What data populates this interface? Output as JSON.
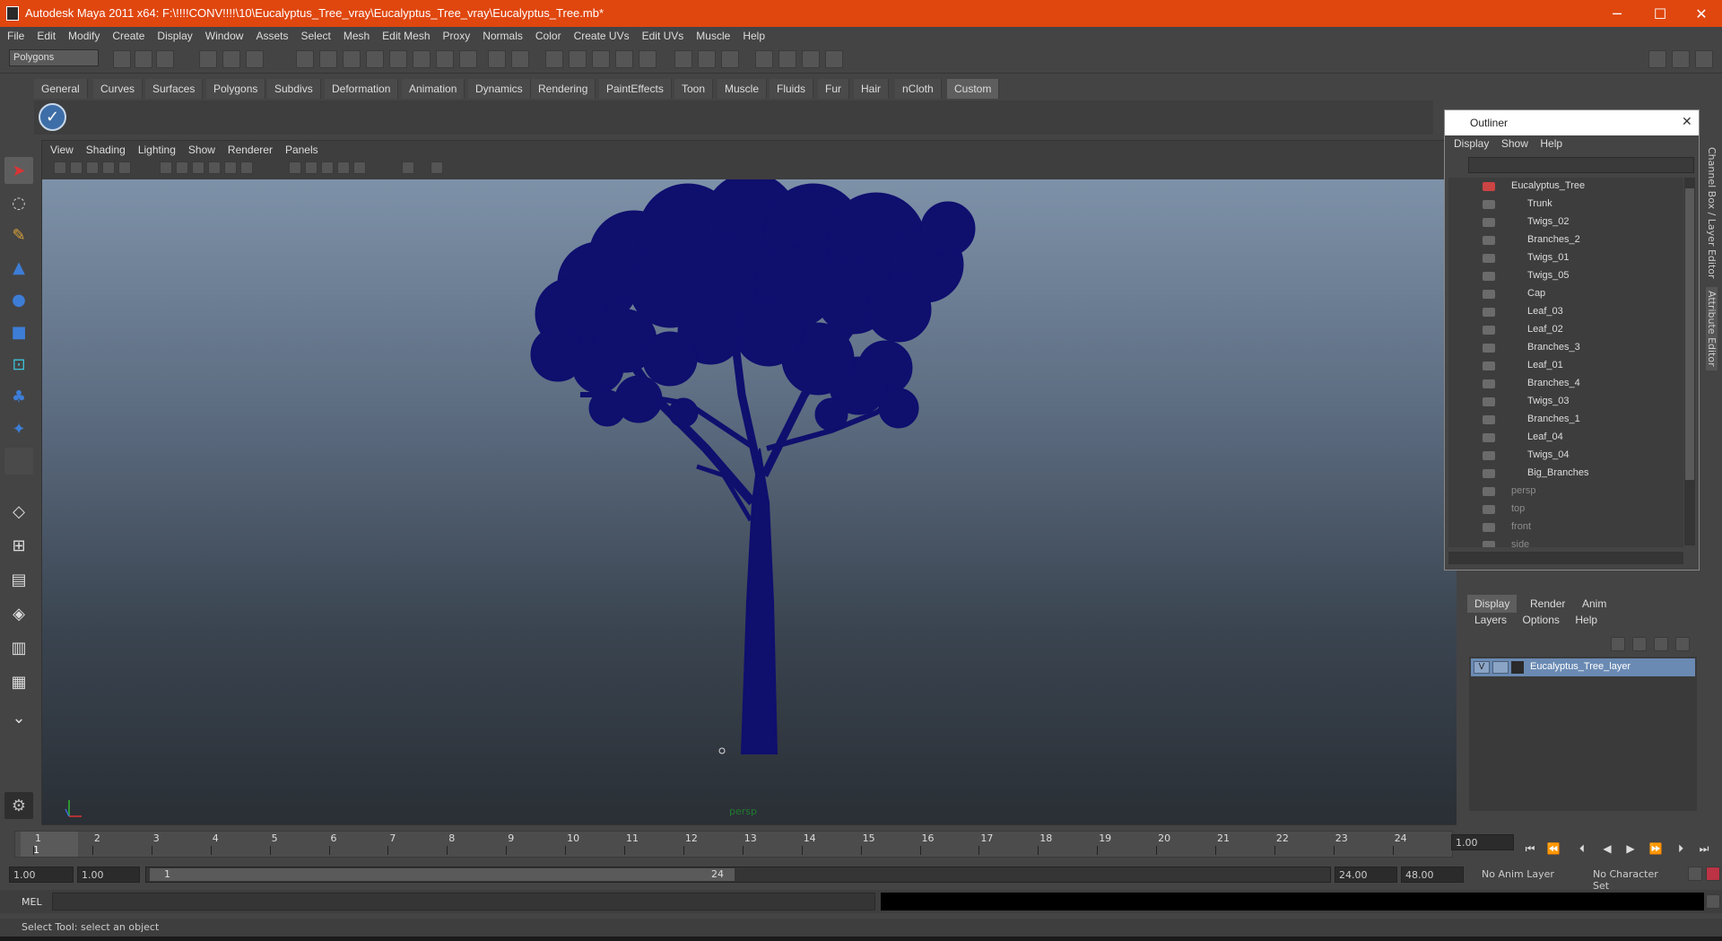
{
  "window": {
    "title": "Autodesk Maya 2011 x64: F:\\!!!!CONV!!!!\\10\\Eucalyptus_Tree_vray\\Eucalyptus_Tree_vray\\Eucalyptus_Tree.mb*",
    "minimize": "─",
    "maximize": "☐",
    "close": "✕"
  },
  "menubar": [
    "File",
    "Edit",
    "Modify",
    "Create",
    "Display",
    "Window",
    "Assets",
    "Select",
    "Mesh",
    "Edit Mesh",
    "Proxy",
    "Normals",
    "Color",
    "Create UVs",
    "Edit UVs",
    "Muscle",
    "Help"
  ],
  "statusline": {
    "mode": "Polygons"
  },
  "shelf_tabs": [
    "General",
    "Curves",
    "Surfaces",
    "Polygons",
    "Subdivs",
    "Deformation",
    "Animation",
    "Dynamics",
    "Rendering",
    "PaintEffects",
    "Toon",
    "Muscle",
    "Fluids",
    "Fur",
    "Hair",
    "nCloth",
    "Custom"
  ],
  "shelf_active": "Custom",
  "viewport": {
    "menu": [
      "View",
      "Shading",
      "Lighting",
      "Show",
      "Renderer",
      "Panels"
    ],
    "camera_label": "persp",
    "tree_color": "#0f0f6e"
  },
  "outliner": {
    "title": "Outliner",
    "menu": [
      "Display",
      "Show",
      "Help"
    ],
    "root": "Eucalyptus_Tree",
    "children": [
      "Trunk",
      "Twigs_02",
      "Branches_2",
      "Twigs_01",
      "Twigs_05",
      "Cap",
      "Leaf_03",
      "Leaf_02",
      "Branches_3",
      "Leaf_01",
      "Branches_4",
      "Twigs_03",
      "Branches_1",
      "Leaf_04",
      "Twigs_04",
      "Big_Branches"
    ],
    "cameras": [
      "persp",
      "top",
      "front",
      "side"
    ]
  },
  "dock_tabs": {
    "channel_box": "Channel Box / Layer Editor",
    "attribute_editor": "Attribute Editor"
  },
  "layer_editor": {
    "tabs": [
      "Display",
      "Render",
      "Anim"
    ],
    "menu": [
      "Layers",
      "Options",
      "Help"
    ],
    "layer": {
      "visible": "V",
      "name": "Eucalyptus_Tree_layer"
    }
  },
  "timeline": {
    "ticks": [
      "1",
      "2",
      "3",
      "4",
      "5",
      "6",
      "7",
      "8",
      "9",
      "10",
      "11",
      "12",
      "13",
      "14",
      "15",
      "16",
      "17",
      "18",
      "19",
      "20",
      "21",
      "22",
      "23",
      "24"
    ],
    "current_frame": "1",
    "current_field": "1.00"
  },
  "range": {
    "start": "1.00",
    "playback_start": "1.00",
    "slider_start": "1",
    "slider_end": "24",
    "playback_end": "24.00",
    "end": "48.00",
    "anim_layer": "No Anim Layer",
    "character_set": "No Character Set"
  },
  "command": {
    "label": "MEL"
  },
  "helpline": "Select Tool: select an object"
}
